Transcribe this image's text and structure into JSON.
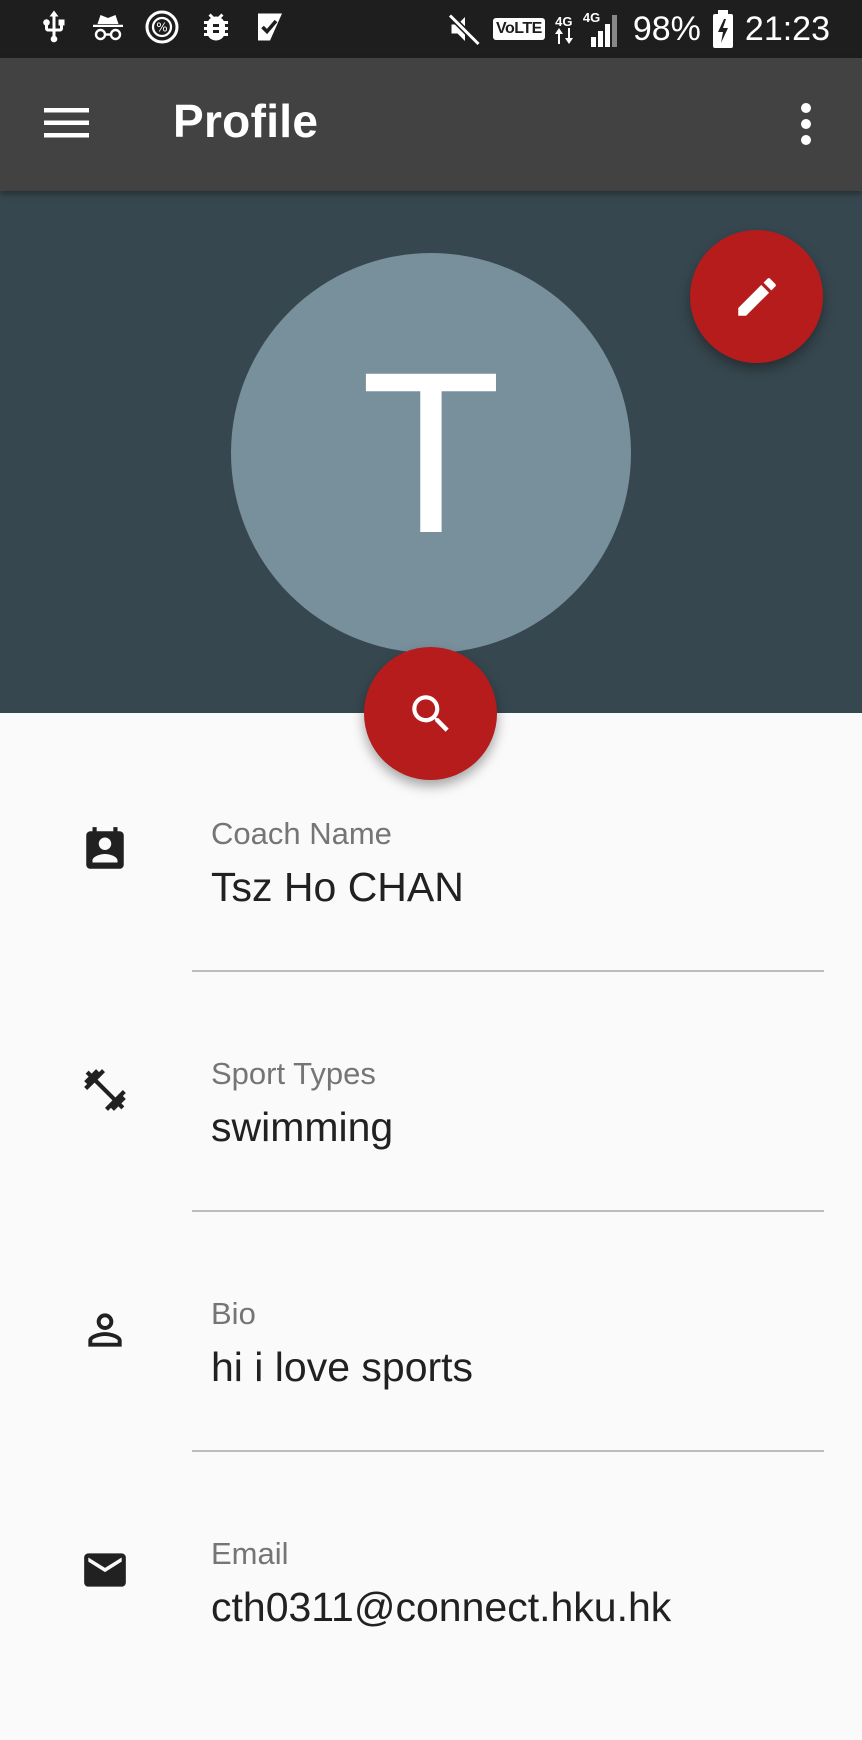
{
  "status_bar": {
    "battery": "98%",
    "time": "21:23",
    "volte": "VoLTE",
    "net_a": "4G",
    "net_b": "4G"
  },
  "app_bar": {
    "title": "Profile"
  },
  "avatar": {
    "initial": "T",
    "color": "#78909c"
  },
  "colors": {
    "header": "#37474f",
    "app_bar": "#424242",
    "fab": "#b71c1c"
  },
  "fields": [
    {
      "icon": "contact-card-icon",
      "label": "Coach Name",
      "value": "Tsz Ho CHAN"
    },
    {
      "icon": "dumbbell-icon",
      "label": "Sport Types",
      "value": "swimming"
    },
    {
      "icon": "person-outline-icon",
      "label": "Bio",
      "value": "hi i love sports"
    },
    {
      "icon": "mail-icon",
      "label": "Email",
      "value": "cth0311@connect.hku.hk"
    }
  ]
}
